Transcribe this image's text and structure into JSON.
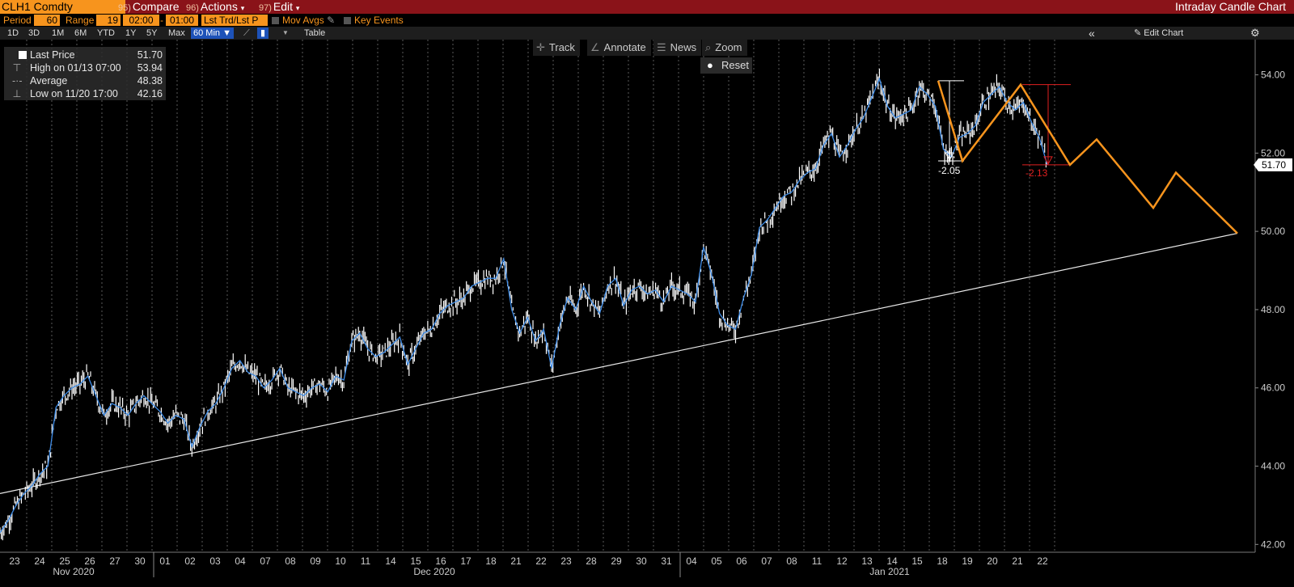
{
  "header": {
    "ticker": "CLH1 Comdty",
    "compare": {
      "num": "95)",
      "label": "Compare"
    },
    "actions": {
      "num": "96)",
      "label": "Actions",
      "arrow": "▾"
    },
    "edit": {
      "num": "97)",
      "label": "Edit",
      "arrow": "▾"
    },
    "title": "Intraday Candle Chart"
  },
  "settings": {
    "period_label": "Period",
    "period_value": "60",
    "range_label": "Range",
    "range_value": "19",
    "time_from": "02:00",
    "time_to": "01:00",
    "trend": "Lst Trd/Lst P",
    "mov_avgs": "Mov Avgs",
    "key_events": "Key Events"
  },
  "timeframes": [
    "1D",
    "3D",
    "1M",
    "6M",
    "YTD",
    "1Y",
    "5Y",
    "Max"
  ],
  "interval_selected": "60 Min ▼",
  "table_label": "Table",
  "edit_chart": "Edit Chart",
  "tools": {
    "track": "Track",
    "annotate": "Annotate",
    "news": "News",
    "zoom": "Zoom",
    "reset": "Reset"
  },
  "legend": {
    "last_price_label": "Last Price",
    "last_price_value": "51.70",
    "high_label": "High on 01/13 07:00",
    "high_value": "53.94",
    "average_label": "Average",
    "average_value": "48.38",
    "low_label": "Low on 11/20 17:00",
    "low_value": "42.16"
  },
  "colors": {
    "accent": "#f7941d",
    "header": "#8a1319",
    "price_line": "#3d8be6",
    "candle": "#ffffff",
    "annotation_red": "#e02020"
  },
  "chart_data": {
    "type": "line",
    "ylim": [
      41.8,
      54.9
    ],
    "y_ticks": [
      "54.00",
      "52.00",
      "50.00",
      "48.00",
      "46.00",
      "44.00",
      "42.00"
    ],
    "x_ticks": [
      "23",
      "24",
      "25",
      "26",
      "27",
      "30",
      "01",
      "02",
      "03",
      "04",
      "07",
      "08",
      "09",
      "10",
      "11",
      "14",
      "15",
      "16",
      "17",
      "18",
      "21",
      "22",
      "23",
      "28",
      "29",
      "30",
      "31",
      "04",
      "05",
      "06",
      "07",
      "08",
      "11",
      "12",
      "13",
      "14",
      "15",
      "18",
      "19",
      "20",
      "21",
      "22"
    ],
    "months": [
      "Nov 2020",
      "Dec 2020",
      "Jan 2021"
    ],
    "last_price_tag": "51.70",
    "series": [
      {
        "values": [
          42.3,
          42.6,
          43.0,
          43.3,
          43.5,
          43.8,
          44.0,
          45.5,
          45.8,
          46.0,
          46.1,
          46.3,
          45.8,
          45.3,
          45.6,
          45.5,
          45.3,
          45.6,
          45.8,
          45.6,
          45.4,
          45.1,
          45.3,
          45.2,
          44.5,
          45.0,
          45.4,
          45.6,
          46.0,
          46.5,
          46.7,
          46.4,
          46.3,
          46.0,
          46.2,
          46.5,
          46.0,
          45.9,
          45.8,
          46.0,
          46.1,
          45.9,
          46.3,
          46.2,
          47.2,
          47.4,
          47.0,
          46.8,
          46.9,
          47.1,
          47.3,
          46.6,
          47.0,
          47.4,
          47.5,
          47.9,
          48.1,
          48.2,
          48.3,
          48.6,
          48.7,
          48.8,
          48.8,
          49.3,
          48.0,
          47.4,
          47.8,
          47.2,
          47.5,
          46.5,
          47.6,
          48.3,
          48.0,
          48.6,
          48.2,
          47.9,
          48.6,
          48.8,
          48.1,
          48.5,
          48.6,
          48.4,
          48.5,
          48.2,
          48.6,
          48.5,
          48.4,
          48.2,
          49.6,
          48.9,
          47.9,
          47.6,
          47.5,
          48.3,
          48.9,
          50.1,
          50.3,
          50.6,
          50.9,
          51.0,
          51.3,
          51.5,
          51.6,
          52.2,
          52.5,
          51.9,
          52.2,
          52.6,
          52.9,
          53.4,
          53.9,
          53.2,
          52.9,
          53.0,
          53.1,
          53.7,
          53.5,
          53.2,
          52.1,
          51.9,
          52.4,
          52.5,
          52.7,
          53.3,
          53.5,
          53.7,
          53.3,
          53.1,
          53.3,
          52.8,
          52.4,
          51.7
        ]
      }
    ],
    "trendline": {
      "start": 43.3,
      "end": 49.95
    },
    "annotations": {
      "drop1": "-2.05",
      "drop2": "-2.13"
    },
    "projection": [
      53.85,
      51.8,
      53.75,
      51.7,
      52.35,
      50.6,
      51.5,
      49.95
    ]
  }
}
